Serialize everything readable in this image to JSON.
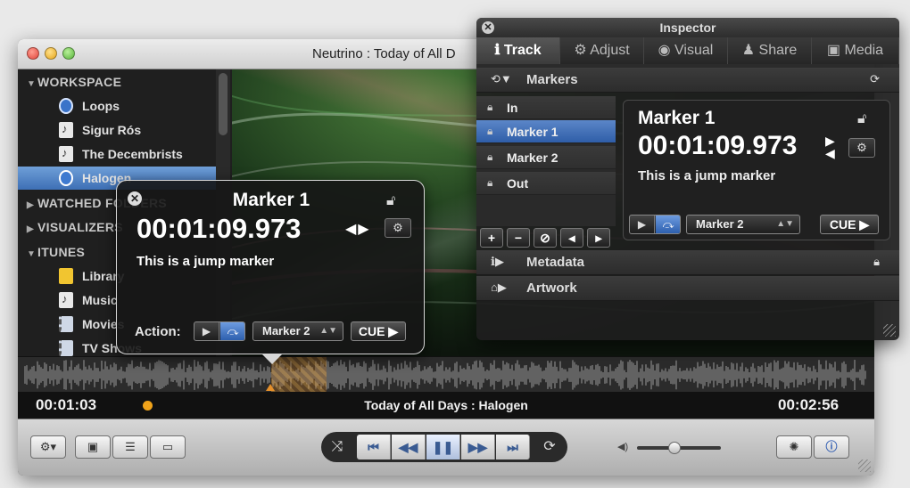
{
  "window": {
    "title": "Neutrino : Today of All D"
  },
  "sidebar": {
    "sections": [
      {
        "label": "WORKSPACE",
        "expanded": true
      },
      {
        "label": "WATCHED FOLDERS",
        "expanded": false
      },
      {
        "label": "VISUALIZERS",
        "expanded": false
      },
      {
        "label": "ITUNES",
        "expanded": true
      }
    ],
    "workspace_items": [
      {
        "label": "Loops",
        "icon": "loop-icon"
      },
      {
        "label": "Sigur Rós",
        "icon": "music-doc-icon"
      },
      {
        "label": "The Decembrists",
        "icon": "music-doc-icon"
      },
      {
        "label": "Halogen",
        "icon": "play-circle-icon",
        "selected": true
      }
    ],
    "itunes_items": [
      {
        "label": "Library",
        "icon": "library-icon"
      },
      {
        "label": "Music",
        "icon": "music-doc-icon"
      },
      {
        "label": "Movies",
        "icon": "film-icon"
      },
      {
        "label": "TV Shows",
        "icon": "film-icon"
      }
    ]
  },
  "status": {
    "elapsed": "00:01:03",
    "now_playing": "Today of All Days : Halogen",
    "total": "00:02:56"
  },
  "hud": {
    "title": "Marker 1",
    "timecode": "00:01:09.973",
    "description": "This is a jump marker",
    "action_label": "Action:",
    "target": "Marker 2",
    "cue_label": "CUE ▶"
  },
  "inspector": {
    "title": "Inspector",
    "tabs": [
      {
        "label": "Track",
        "icon": "info-icon",
        "active": true
      },
      {
        "label": "Adjust",
        "icon": "gear-icon"
      },
      {
        "label": "Visual",
        "icon": "eye-icon"
      },
      {
        "label": "Share",
        "icon": "person-icon"
      },
      {
        "label": "Media",
        "icon": "film-icon"
      }
    ],
    "markers_header": "Markers",
    "markers": [
      {
        "label": "In"
      },
      {
        "label": "Marker 1",
        "selected": true
      },
      {
        "label": "Marker 2"
      },
      {
        "label": "Out"
      }
    ],
    "detail": {
      "title": "Marker 1",
      "timecode": "00:01:09.973",
      "description": "This is a jump marker",
      "target": "Marker 2",
      "cue_label": "CUE ▶"
    },
    "metadata_header": "Metadata",
    "artwork_header": "Artwork"
  },
  "playback": {
    "volume_fraction": 0.44
  },
  "colors": {
    "accent": "#3d6fb5",
    "marker": "#e5902b"
  }
}
